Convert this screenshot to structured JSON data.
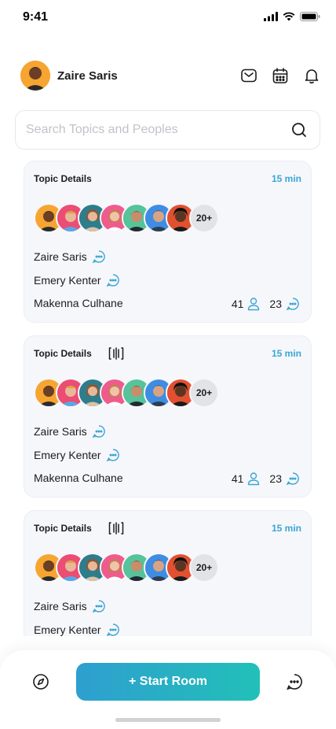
{
  "status": {
    "time": "9:41"
  },
  "header": {
    "user_name": "Zaire Saris",
    "icons": [
      "mail-icon",
      "calendar-icon",
      "bell-icon"
    ]
  },
  "search": {
    "placeholder": "Search Topics and Peoples",
    "value": ""
  },
  "cards": [
    {
      "title": "Topic Details",
      "duration": "15 min",
      "has_waveform_icon": false,
      "more_count": "20+",
      "members": [
        "Zaire Saris",
        "Emery Kenter",
        "Makenna Culhane"
      ],
      "listeners": "41",
      "messages": "23"
    },
    {
      "title": "Topic Details",
      "duration": "15 min",
      "has_waveform_icon": true,
      "more_count": "20+",
      "members": [
        "Zaire Saris",
        "Emery Kenter",
        "Makenna Culhane"
      ],
      "listeners": "41",
      "messages": "23"
    },
    {
      "title": "Topic Details",
      "duration": "15 min",
      "has_waveform_icon": true,
      "more_count": "20+",
      "members": [
        "Zaire Saris",
        "Emery Kenter"
      ],
      "listeners": "",
      "messages": ""
    }
  ],
  "bottom": {
    "start_label": "+ Start  Room"
  },
  "colors": {
    "accent": "#3aa6d4",
    "gradient_start": "#2e9fd0",
    "gradient_end": "#22c0b8"
  }
}
